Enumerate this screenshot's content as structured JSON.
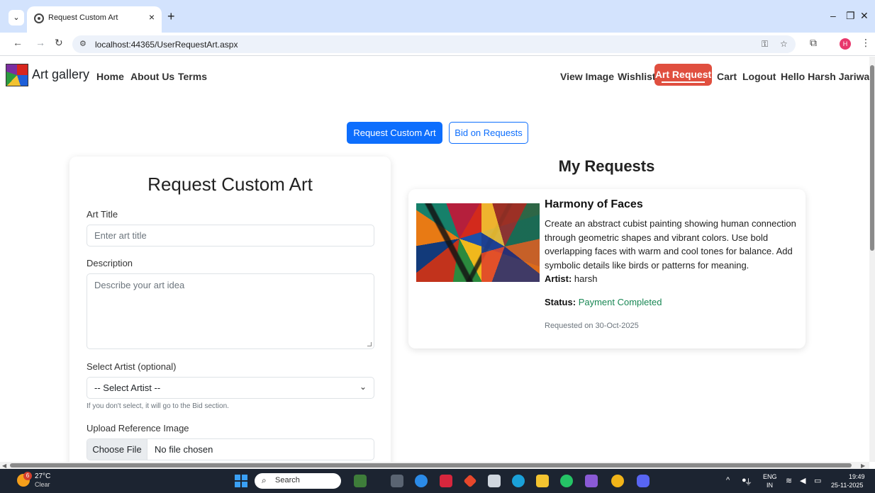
{
  "browser": {
    "tab_title": "Request Custom Art",
    "url": "localhost:44365/UserRequestArt.aspx",
    "profile_initial": "H"
  },
  "navbar": {
    "brand": "Art gallery",
    "left_links": [
      "Home",
      "About Us",
      "Terms"
    ],
    "right_links": [
      "View Image",
      "Wishlist",
      "Art Request",
      "Cart",
      "Logout"
    ],
    "active_link": "Art Request",
    "greeting": "Hello Harsh Jariwala",
    "active_color": "#e04f3f"
  },
  "actions": {
    "request_label": "Request Custom Art",
    "bid_label": "Bid on Requests",
    "accent_color": "#0d6efd"
  },
  "form": {
    "title": "Request Custom Art",
    "art_title_label": "Art Title",
    "art_title_placeholder": "Enter art title",
    "description_label": "Description",
    "description_placeholder": "Describe your art idea",
    "artist_label": "Select Artist (optional)",
    "artist_selected": "-- Select Artist --",
    "artist_hint": "If you don't select, it will go to the Bid section.",
    "upload_label": "Upload Reference Image",
    "file_button": "Choose File",
    "file_status": "No file chosen"
  },
  "my_requests": {
    "heading": "My Requests",
    "items": [
      {
        "title": "Harmony of Faces",
        "description": "Create an abstract cubist painting showing human connection through geometric shapes and vibrant colors. Use bold overlapping faces with warm and cool tones for balance. Add symbolic details like birds or patterns for meaning.",
        "artist_label": "Artist:",
        "artist": "harsh",
        "status_label": "Status:",
        "status": "Payment Completed",
        "status_color": "#198754",
        "requested_on": "Requested on 30-Oct-2025"
      }
    ]
  },
  "taskbar": {
    "temperature": "27°C",
    "condition": "Clear",
    "weather_badge": "6",
    "search_label": "Search",
    "lang_top": "ENG",
    "lang_bottom": "IN",
    "time": "19:49",
    "date": "25-11-2025"
  }
}
